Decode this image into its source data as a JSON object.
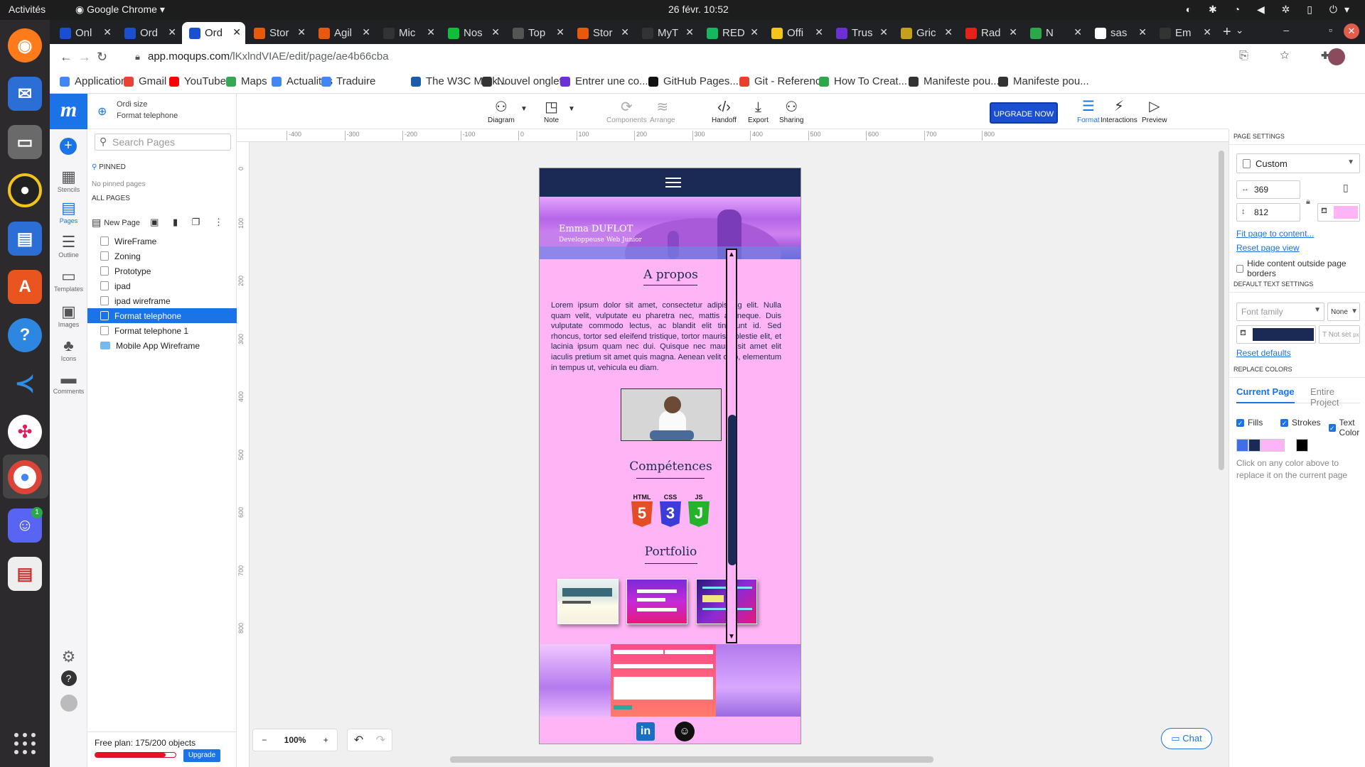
{
  "os": {
    "activities": "Activités",
    "app_name": "Google Chrome",
    "clock": "26 févr.  10:52",
    "discord_badge": "1"
  },
  "browser": {
    "tabs": [
      {
        "label": "Onl",
        "color": "#1b4fd1"
      },
      {
        "label": "Ord",
        "color": "#1b4fd1"
      },
      {
        "label": "Ord",
        "color": "#1b4fd1",
        "active": true
      },
      {
        "label": "Stor",
        "color": "#e8590c"
      },
      {
        "label": "Agil",
        "color": "#e8590c"
      },
      {
        "label": "Mic",
        "color": "#333333"
      },
      {
        "label": "Nos",
        "color": "#0fbf3a"
      },
      {
        "label": "Top",
        "color": "#555555"
      },
      {
        "label": "Stor",
        "color": "#e8590c"
      },
      {
        "label": "MyT",
        "color": "#333333"
      },
      {
        "label": "RED",
        "color": "#16b85f"
      },
      {
        "label": "Offi",
        "color": "#f5c518"
      },
      {
        "label": "Trus",
        "color": "#6b2fd6"
      },
      {
        "label": "Gric",
        "color": "#c7a01b"
      },
      {
        "label": "Rad",
        "color": "#e62117"
      },
      {
        "label": "N",
        "color": "#2aa84a"
      },
      {
        "label": "sas",
        "color": "#ffffff"
      },
      {
        "label": "Em",
        "color": "#333333"
      }
    ],
    "url_host": "app.moqups.com",
    "url_path": "/lKxlndVIAE/edit/page/ae4b66cba",
    "bookmarks": [
      {
        "label": "Applications",
        "color": "#4285f4"
      },
      {
        "label": "Gmail",
        "color": "#ea4335"
      },
      {
        "label": "YouTube",
        "color": "#ff0000"
      },
      {
        "label": "Maps",
        "color": "#34a853"
      },
      {
        "label": "Actualités",
        "color": "#4285f4"
      },
      {
        "label": "Traduire",
        "color": "#4285f4"
      },
      {
        "label": "The W3C Mark...",
        "color": "#1a5ca8"
      },
      {
        "label": "Nouvel onglet",
        "color": "#333333"
      },
      {
        "label": "Entrer une co...",
        "color": "#6b2fd6"
      },
      {
        "label": "GitHub Pages...",
        "color": "#111111"
      },
      {
        "label": "Git - Reference",
        "color": "#e8402a"
      },
      {
        "label": "How To Creat...",
        "color": "#2aa84a"
      },
      {
        "label": "Manifeste pou...",
        "color": "#333333"
      },
      {
        "label": "Manifeste pou...",
        "color": "#333333"
      }
    ]
  },
  "moqups": {
    "logo": "m",
    "rail": [
      {
        "label": "Stencils",
        "icon": "stencils-icon",
        "glyph": "▦"
      },
      {
        "label": "Pages",
        "icon": "pages-icon",
        "glyph": "▤",
        "selected": true
      },
      {
        "label": "Outline",
        "icon": "outline-icon",
        "glyph": "☰"
      },
      {
        "label": "Templates",
        "icon": "templates-icon",
        "glyph": "▭"
      },
      {
        "label": "Images",
        "icon": "images-icon",
        "glyph": "▣"
      },
      {
        "label": "Icons",
        "icon": "icons-icon",
        "glyph": "♣"
      },
      {
        "label": "Comments",
        "icon": "comments-icon",
        "glyph": "▬"
      }
    ],
    "project": {
      "title": "Ordi size",
      "page": "Format telephone"
    },
    "search_placeholder": "Search Pages",
    "pinned_header": "PINNED",
    "no_pinned": "No pinned pages",
    "all_pages_header": "ALL PAGES",
    "new_page": "New Page",
    "pages": [
      {
        "label": "WireFrame"
      },
      {
        "label": "Zoning"
      },
      {
        "label": "Prototype"
      },
      {
        "label": "ipad"
      },
      {
        "label": "ipad wireframe"
      },
      {
        "label": "Format telephone",
        "selected": true
      },
      {
        "label": "Format telephone 1"
      },
      {
        "label": "Mobile App Wireframe",
        "folder": true
      }
    ],
    "plan_text": "Free plan: 175/200 objects",
    "plan_usage": 0.875,
    "upgrade_small": "Upgrade",
    "toolbar": {
      "diagram": "Diagram",
      "note": "Note",
      "components": "Components",
      "arrange": "Arrange",
      "handoff": "Handoff",
      "export": "Export",
      "sharing": "Sharing",
      "upgrade_now": "UPGRADE NOW",
      "format": "Format",
      "interactions": "Interactions",
      "preview": "Preview"
    },
    "ruler_h": [
      "-400",
      "-300",
      "-200",
      "-100",
      "0",
      "100",
      "200",
      "300",
      "400",
      "500",
      "600",
      "700",
      "800"
    ],
    "ruler_v": [
      "0",
      "100",
      "200",
      "300",
      "400",
      "500",
      "600",
      "700",
      "800"
    ],
    "zoom": "100%",
    "chat": "Chat"
  },
  "mockup": {
    "name": "Emma DUFLOT",
    "role": "Developpeuse Web Junior",
    "about_title": "A propos",
    "about_text": "Lorem ipsum dolor sit amet, consectetur adipiscing elit. Nulla quam velit, vulputate eu pharetra nec, mattis ac neque. Duis vulputate commodo lectus, ac blandit elit tincidunt id. Sed rhoncus, tortor sed eleifend tristique, tortor mauris molestie elit, et lacinia ipsum quam nec dui. Quisque nec mauris sit amet elit iaculis pretium sit amet quis magna. Aenean velit odio, elementum in tempus ut, vehicula eu diam.",
    "skills_title": "Compétences",
    "skills": [
      {
        "label": "HTML",
        "glyph": "5",
        "color": "#e44d26"
      },
      {
        "label": "CSS",
        "glyph": "3",
        "color": "#3c3cd8"
      },
      {
        "label": "JS",
        "glyph": "J",
        "color": "#22b32a"
      }
    ],
    "portfolio_title": "Portfolio",
    "linkedin": "in"
  },
  "format_panel": {
    "page_settings": "PAGE SETTINGS",
    "size_preset": "Custom",
    "width": "369",
    "height": "812",
    "page_color": "#ffb4f5",
    "fit_link": "Fit page to content...",
    "reset_view": "Reset page view",
    "hide_outside": "Hide content outside page borders",
    "default_text": "DEFAULT TEXT SETTINGS",
    "font_family_placeholder": "Font family",
    "font_style": "None",
    "text_color": "#1a2a55",
    "font_size_placeholder": "Not set",
    "font_size_unit": "px",
    "reset_defaults": "Reset defaults",
    "replace_colors": "REPLACE COLORS",
    "tab_current": "Current Page",
    "tab_entire": "Entire Project",
    "fills": "Fills",
    "strokes": "Strokes",
    "text_color_label": "Text Color",
    "colors": [
      "#3d6fe8",
      "#1a2a55",
      "#ffb4f5",
      "#000000"
    ],
    "hint": "Click on any color above to replace it on the current page"
  }
}
